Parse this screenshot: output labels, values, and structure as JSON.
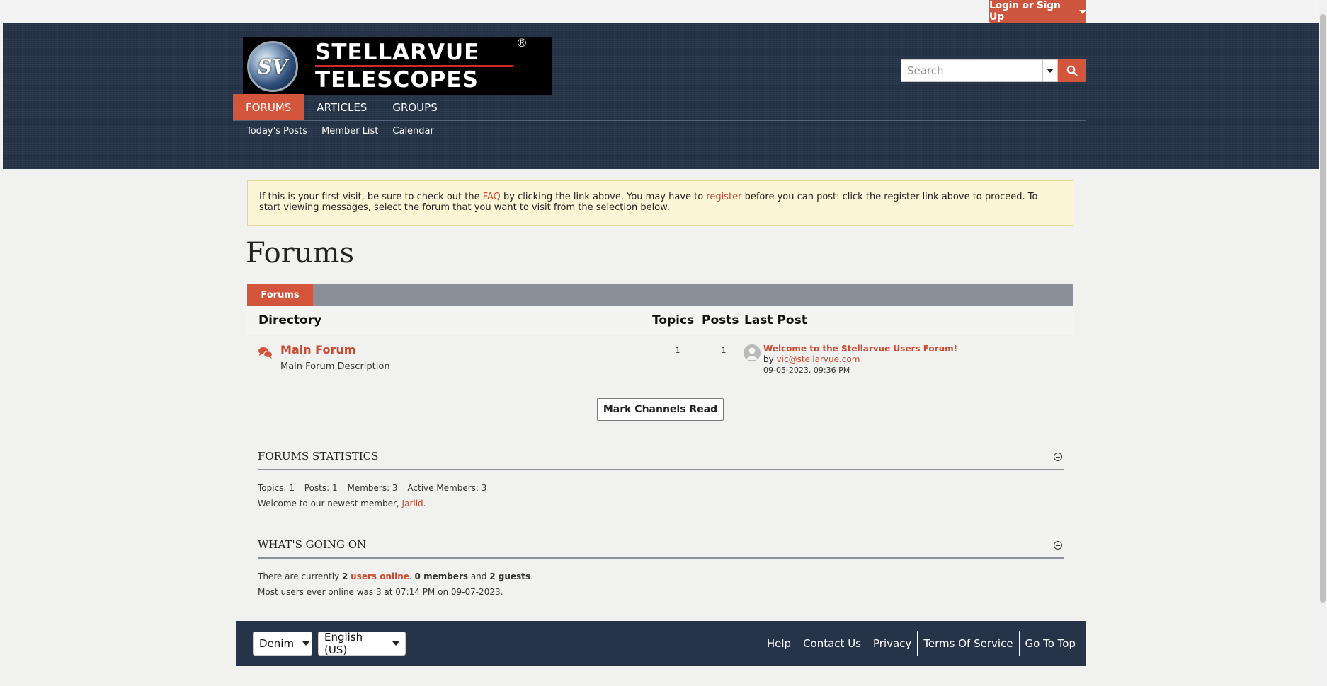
{
  "topbar": {
    "login_label": "Login or Sign Up"
  },
  "header": {
    "logo": {
      "emblem": "SV",
      "line1": "STELLARVUE",
      "line2": "TELESCOPES",
      "reg": "®"
    },
    "search": {
      "placeholder": "Search"
    },
    "nav": {
      "tabs": [
        {
          "label": "FORUMS",
          "active": true
        },
        {
          "label": "ARTICLES",
          "active": false
        },
        {
          "label": "GROUPS",
          "active": false
        }
      ],
      "subnav": [
        "Today's Posts",
        "Member List",
        "Calendar"
      ]
    }
  },
  "notice": {
    "part1": "If this is your first visit, be sure to check out the ",
    "faq": "FAQ",
    "part2": " by clicking the link above. You may have to ",
    "register": "register",
    "part3": " before you can post: click the register link above to proceed. To start viewing messages, select the forum that you want to visit from the selection below."
  },
  "page_title": "Forums",
  "forum_table": {
    "tab": "Forums",
    "headers": {
      "directory": "Directory",
      "topics": "Topics",
      "posts": "Posts",
      "last_post": "Last Post"
    },
    "rows": [
      {
        "title": "Main Forum",
        "description": "Main Forum Description",
        "topics": "1",
        "posts": "1",
        "last_post": {
          "title": "Welcome to the Stellarvue Users Forum!",
          "by": "by ",
          "author": "vic@stellarvue.com",
          "date": "09-05-2023, 09:36 PM"
        }
      }
    ]
  },
  "mark_read_label": "Mark Channels Read",
  "statistics": {
    "title": "FORUMS STATISTICS",
    "topics": "Topics: 1",
    "posts": "Posts: 1",
    "members": "Members: 3",
    "active": "Active Members: 3",
    "welcome_prefix": "Welcome to our newest member, ",
    "newest_member": "Jarild",
    "welcome_suffix": "."
  },
  "whats_going_on": {
    "title": "WHAT'S GOING ON",
    "t1": "There are currently ",
    "count": "2",
    "users_online": "users online",
    "t2": ". ",
    "members": "0 members",
    "t3": " and ",
    "guests": "2 guests",
    "t4": ".",
    "record": "Most users ever online was 3 at 07:14 PM on 09-07-2023."
  },
  "footer": {
    "style_select": "Denim",
    "language_select": "English (US)",
    "links": [
      "Help",
      "Contact Us",
      "Privacy",
      "Terms Of Service",
      "Go To Top"
    ]
  },
  "colors": {
    "accent": "#d2553c",
    "header_bg": "#263348",
    "notice_bg": "#fcf5d6"
  }
}
